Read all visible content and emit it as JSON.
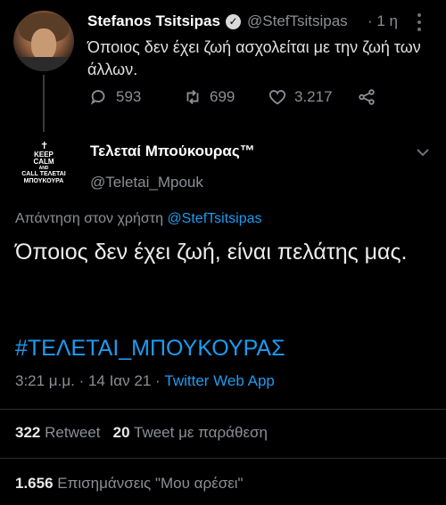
{
  "original_tweet": {
    "author_name": "Stefanos Tsitsipas",
    "handle": "@StefTsitsipas",
    "time": "· 1 η",
    "text": "Όποιος δεν έχει ζωή ασχολείται με την ζωή των άλλων.",
    "replies": "593",
    "retweets": "699",
    "likes": "3.217"
  },
  "reply_tweet": {
    "author_name": "Τελεταί Μπούκουρας™",
    "handle": "@Teletai_Mpouk",
    "avatar_text": {
      "line1": "KEEP",
      "line2": "CALM",
      "line3": "AND",
      "line4": "CALL ΤΕΛΕΤΑΙ",
      "line5": "ΜΠΟΥΚΟΥΡΑ"
    },
    "reply_prefix": "Απάντηση στον χρήστη",
    "reply_mention": "@StefTsitsipas",
    "text": "Όποιος δεν έχει ζωή, είναι πελάτης μας.",
    "hashtag": "#ΤΕΛΕΤΑΙ_ΜΠΟΥΚΟΥΡΑΣ",
    "time": "3:21 μ.μ. · 14 Ιαν 21 ·",
    "app": "Twitter Web App",
    "retweet_count": "322",
    "retweet_label": "Retweet",
    "quote_count": "20",
    "quote_label": "Tweet με παράθεση",
    "like_count": "1.656",
    "like_label": "Επισημάνσεις \"Μου αρέσει\""
  },
  "colors": {
    "background": "#000000",
    "link": "#1d9bf0",
    "secondary_text": "#8b8f94"
  }
}
